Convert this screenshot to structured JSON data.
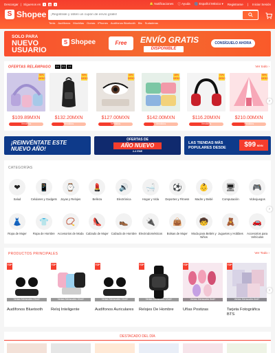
{
  "topbar": {
    "left_links": [
      "Descargar",
      "Síguenos en"
    ],
    "notifications": "Notificaciones",
    "help": "Ayuda",
    "language": "Español México",
    "register": "Registrarse",
    "login": "Iniciar Sesión"
  },
  "brand": {
    "logo_text": "Shopee",
    "color": "#f53d2d"
  },
  "search": {
    "placeholder": "¡Regístrate y obtén un cupón de envío gratis!",
    "keywords": [
      "Tenis",
      "Audífonos",
      "Mochilas",
      "Gorras",
      "iPhones",
      "Audífonos Bluetooth",
      "Bts",
      "Sudaderas"
    ]
  },
  "banner": {
    "line1": "SOLO PARA",
    "line2": "NUEVO",
    "line3": "USUARIO",
    "brand": "Shopee",
    "truck_label": "Free",
    "free_shipping": "ENVÍO GRATIS",
    "available": "DISPONIBLE",
    "cta": "CONSÍGUELO AHORA"
  },
  "flash": {
    "title": "OFERTAS RELÁMPAGO",
    "timer": [
      "04",
      "33",
      "15"
    ],
    "see_all": "Ver todo",
    "items": [
      {
        "price": "$109.89MXN",
        "discount": "50%",
        "off": "DESC.",
        "sold_label": "Vendidos",
        "sold_fraction": 0.55,
        "icon": "headphones-icon"
      },
      {
        "price": "$132.20MXN",
        "discount": "53%",
        "off": "DESC.",
        "sold_label": "Vendidos",
        "sold_fraction": 0.35,
        "icon": "backpack-icon"
      },
      {
        "price": "$127.00MXN",
        "discount": "30%",
        "off": "DESC.",
        "sold_label": "Vendidos",
        "sold_fraction": 0.45,
        "icon": "eyelash-icon"
      },
      {
        "price": "$142.00MXN",
        "discount": "18%",
        "off": "DESC.",
        "sold_label": "Vendidos",
        "sold_fraction": 0.3,
        "icon": "lunchbox-icon"
      },
      {
        "price": "$116.20MXN",
        "discount": "72%",
        "off": "DESC.",
        "sold_label": "Vendidos",
        "sold_fraction": 0.6,
        "icon": "headphones-icon"
      },
      {
        "price": "$210.00MXN",
        "discount": "50%",
        "off": "DESC.",
        "sold_label": "Vendidos",
        "sold_fraction": 0.4,
        "icon": "tent-icon"
      }
    ]
  },
  "promos": [
    {
      "text": "¡REINVÉNTATE ESTE NUEVO AÑO!"
    },
    {
      "top": "OFERTAS DE",
      "main": "AÑO NUEVO",
      "date": "2-4 ENE"
    },
    {
      "text": "LAS TIENDAS MÁS POPULARES DESDE",
      "price": "$99",
      "unit": "MXN"
    }
  ],
  "categories": {
    "title": "CATEGORÍAS",
    "items": [
      {
        "label": "Salud",
        "icon": "heart-icon"
      },
      {
        "label": "Celulares y Gadgets",
        "icon": "phone-icon"
      },
      {
        "label": "Joyas y Relojes",
        "icon": "watch-icon"
      },
      {
        "label": "Belleza",
        "icon": "makeup-icon"
      },
      {
        "label": "Electrónica",
        "icon": "speaker-icon"
      },
      {
        "label": "Hogar y Vida",
        "icon": "towel-icon"
      },
      {
        "label": "Deportes y Fitness",
        "icon": "soccer-ball-icon"
      },
      {
        "label": "Madre y Bebé",
        "icon": "baby-icon"
      },
      {
        "label": "Computación",
        "icon": "monitor-icon"
      },
      {
        "label": "Videojuegos",
        "icon": "gamepad-icon"
      },
      {
        "label": "Ropa de Mujer",
        "icon": "dress-icon"
      },
      {
        "label": "Ropa de Hombre",
        "icon": "tshirt-icon"
      },
      {
        "label": "Accesorios de Moda",
        "icon": "necklace-icon"
      },
      {
        "label": "Calzado de Mujer",
        "icon": "heels-icon"
      },
      {
        "label": "Calzado de Hombre",
        "icon": "shoe-icon"
      },
      {
        "label": "Electrodomésticos",
        "icon": "appliance-icon"
      },
      {
        "label": "Bolsas de Mujer",
        "icon": "handbag-icon"
      },
      {
        "label": "Moda para Bebés y Niños",
        "icon": "kids-icon"
      },
      {
        "label": "Juguetes y Hobbies",
        "icon": "toy-icon"
      },
      {
        "label": "Accesorios para Vehículos",
        "icon": "car-icon"
      }
    ]
  },
  "top_products": {
    "title": "PRODUCTOS PRINCIPALES",
    "see_all": "Ver Todo",
    "tag": "TOP",
    "items": [
      {
        "name": "Audífonos Bluetooth",
        "sales": "Ventas Mensuales 23mil+",
        "icon": "earbuds-icon"
      },
      {
        "name": "Reloj Inteligente",
        "sales": "Ventas Mensuales 10mil+",
        "icon": "smartwatch-icon"
      },
      {
        "name": "Audífonos Auriculares",
        "sales": "Ventas Mensuales 13mil+",
        "icon": "earbuds-icon"
      },
      {
        "name": "Relojes De Hombre",
        "sales": "Ventas Mensuales 12mil+",
        "icon": "watch-icon"
      },
      {
        "name": "Uñas Postizas",
        "sales": "Ventas Mensuales 5mil+",
        "icon": "nails-icon"
      },
      {
        "name": "Tarjeta Fotográfica BTS",
        "sales": "Ventas Mensuales 6mil+",
        "icon": "photocard-icon"
      }
    ]
  },
  "daily": {
    "title": "DESTACADO DEL DÍA"
  }
}
